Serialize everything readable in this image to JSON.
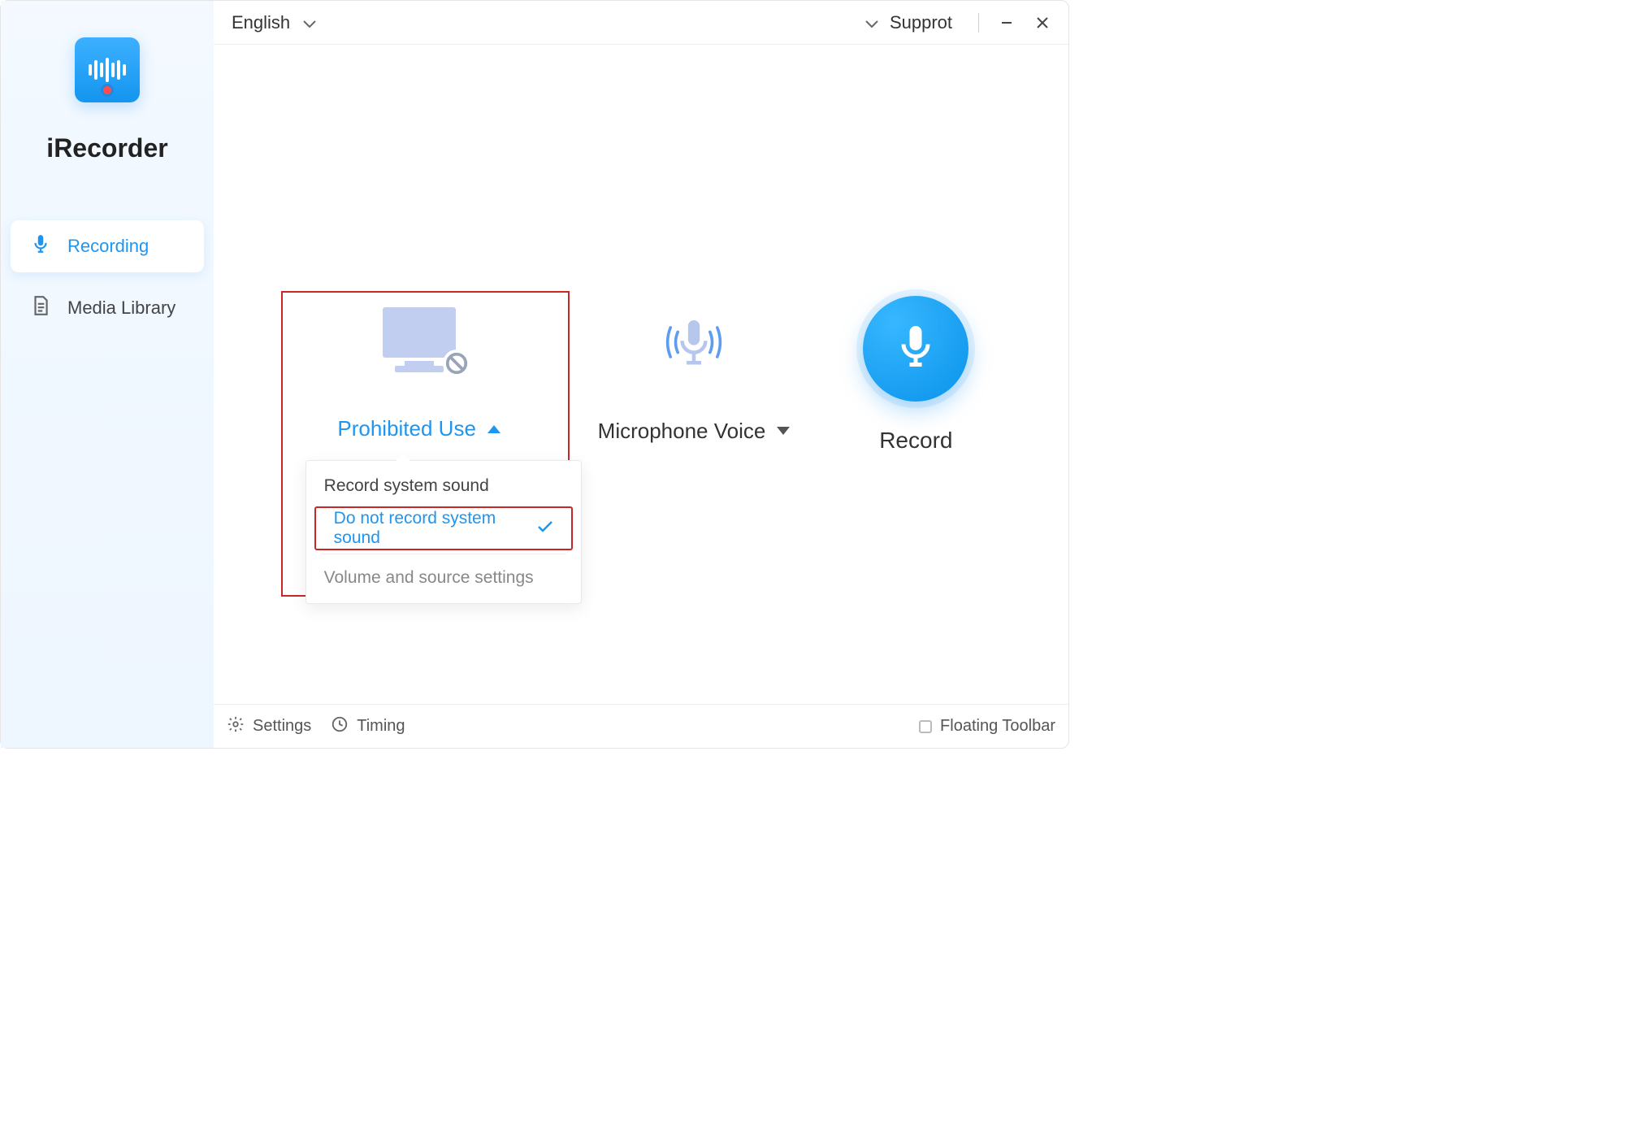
{
  "app_name": "iRecorder",
  "sidebar": {
    "items": [
      {
        "label": "Recording"
      },
      {
        "label": "Media Library"
      }
    ]
  },
  "topbar": {
    "language": "English",
    "support": "Supprot"
  },
  "system_sound": {
    "label": "Prohibited Use",
    "options": [
      "Record system sound",
      "Do not record system sound",
      "Volume and source settings"
    ]
  },
  "microphone": {
    "label": "Microphone Voice"
  },
  "record": {
    "label": "Record"
  },
  "statusbar": {
    "settings": "Settings",
    "timing": "Timing",
    "floating": "Floating Toolbar"
  }
}
